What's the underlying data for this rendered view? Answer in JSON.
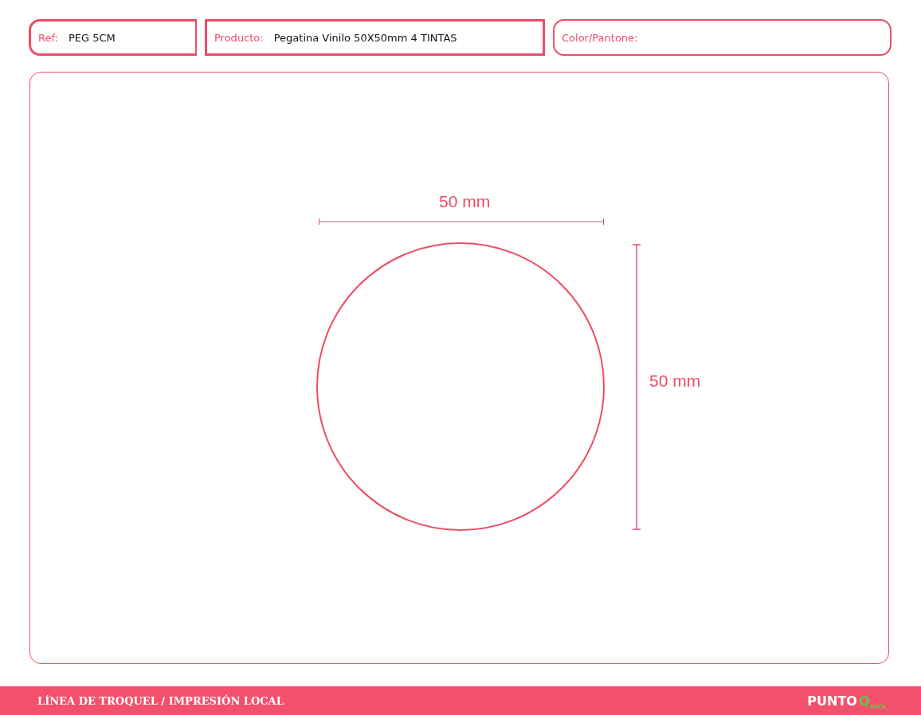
{
  "header": [
    {
      "label": "Ref:",
      "value": "PEG 5CM",
      "kind": "left"
    },
    {
      "label": "Producto:",
      "value": "Pegatina Vinilo 50X50mm 4 TINTAS",
      "kind": "square"
    },
    {
      "label": "Color/Pantone:",
      "kind": "round"
    }
  ],
  "drawing": {
    "width_label": "50 mm",
    "height_label": "50 mm"
  },
  "footer": {
    "title": "LÍNEA DE TROQUEL / IMPRESIÓN LOCAL",
    "logo": {
      "word": "PUNTO",
      "letter": "Q",
      "sub": "PACK"
    }
  }
}
